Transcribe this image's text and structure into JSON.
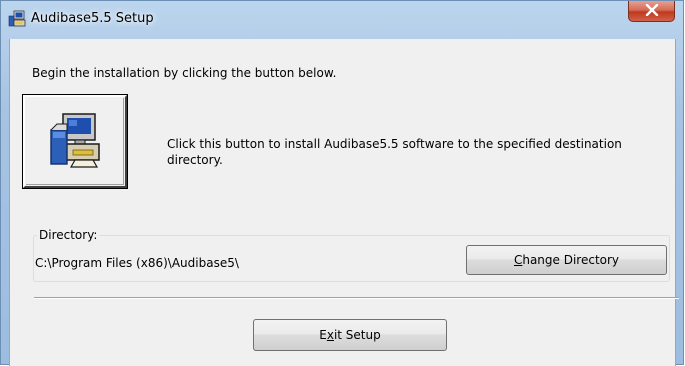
{
  "window": {
    "title": "Audibase5.5 Setup",
    "close_label": "x"
  },
  "main": {
    "instruction": "Begin the installation by clicking the button below.",
    "install_description": "Click this button to install Audibase5.5 software to the specified destination directory.",
    "install_icon": "computer-setup-icon"
  },
  "directory": {
    "legend": "Directory:",
    "path": "C:\\Program Files (x86)\\Audibase5\\",
    "change_button": {
      "mnemonic": "C",
      "rest": "hange Directory"
    }
  },
  "footer": {
    "exit_button": {
      "before": "E",
      "mnemonic": "x",
      "after": "it Setup"
    }
  },
  "colors": {
    "close_button": "#c7432b",
    "client_background": "#f0f0f0",
    "frame": "#a6c3e3"
  }
}
